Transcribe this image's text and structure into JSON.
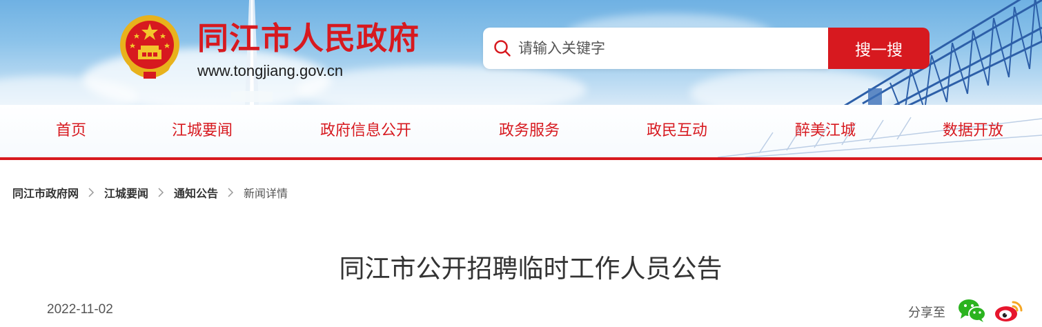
{
  "header": {
    "site_title": "同江市人民政府",
    "site_domain": "www.tongjiang.gov.cn",
    "search": {
      "placeholder": "请输入关键字",
      "button_label": "搜一搜"
    }
  },
  "nav": {
    "items": [
      {
        "label": "首页"
      },
      {
        "label": "江城要闻"
      },
      {
        "label": "政府信息公开"
      },
      {
        "label": "政务服务"
      },
      {
        "label": "政民互动"
      },
      {
        "label": "醉美江城"
      },
      {
        "label": "数据开放"
      }
    ]
  },
  "breadcrumb": {
    "items": [
      {
        "label": "同江市政府网"
      },
      {
        "label": "江城要闻"
      },
      {
        "label": "通知公告"
      }
    ],
    "current": "新闻详情"
  },
  "article": {
    "title": "同江市公开招聘临时工作人员公告",
    "date": "2022-11-02",
    "share_label": "分享至",
    "share_targets": [
      "wechat-icon",
      "weibo-icon"
    ]
  },
  "colors": {
    "accent": "#d7191f",
    "text": "#333333",
    "muted": "#555555",
    "banner_sky": "#8cc3ea",
    "bridge_blue": "#2d5fa8"
  }
}
